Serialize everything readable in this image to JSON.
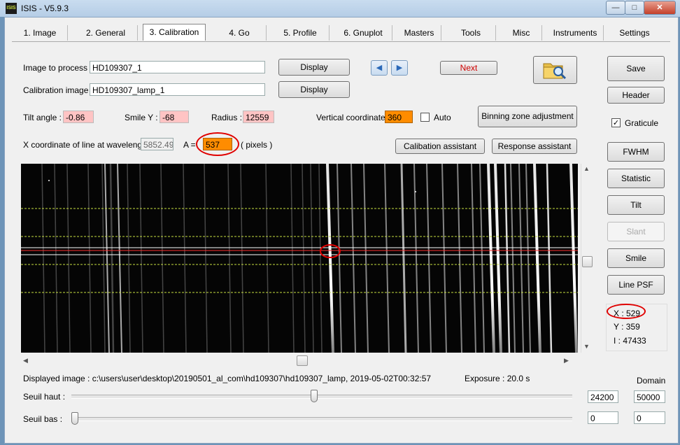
{
  "window": {
    "title": "ISIS - V5.9.3",
    "app_icon_text": "ISIS"
  },
  "tabs": [
    {
      "label": "1. Image"
    },
    {
      "label": "2. General"
    },
    {
      "label": "3. Calibration"
    },
    {
      "label": "4. Go"
    },
    {
      "label": "5. Profile"
    },
    {
      "label": "6. Gnuplot"
    },
    {
      "label": "Masters"
    },
    {
      "label": "Tools"
    },
    {
      "label": "Misc"
    },
    {
      "label": "Instruments"
    },
    {
      "label": "Settings"
    }
  ],
  "form": {
    "image_to_process_label": "Image to process :",
    "image_to_process_value": "HD109307_1",
    "calibration_image_label": "Calibration image :",
    "calibration_image_value": "HD109307_lamp_1",
    "display_label": "Display",
    "next_label": "Next",
    "tilt_label": "Tilt angle :",
    "tilt_value": "-0.86",
    "smile_label": "Smile Y :",
    "smile_value": "-68",
    "radius_label": "Radius :",
    "radius_value": "12559",
    "vertical_label": "Vertical coordinate :",
    "vertical_value": "360",
    "auto_label": "Auto",
    "binning_label": "Binning zone adjustment",
    "xcoord_label": "X coordinate of line at wavelength",
    "wavelength_value": "5852.49",
    "a_label": "A =",
    "pixel_value": "537",
    "pixels_label": "( pixels )",
    "calib_assistant_label": "Calibation assistant",
    "response_assistant_label": "Response assistant"
  },
  "sidebar": {
    "save": "Save",
    "header": "Header",
    "graticule": "Graticule",
    "fwhm": "FWHM",
    "statistic": "Statistic",
    "tilt": "Tilt",
    "slant": "Slant",
    "smile": "Smile",
    "line_psf": "Line PSF"
  },
  "readout": {
    "x": "X : 529",
    "y": "Y : 359",
    "i": "I : 47433"
  },
  "bottom": {
    "displayed_image": "Displayed image : c:\\users\\user\\desktop\\20190501_al_com\\hd109307\\hd109307_lamp, 2019-05-02T00:32:57",
    "exposure": "Exposure : 20.0 s",
    "domain_label": "Domain",
    "seuil_haut_label": "Seuil haut :",
    "seuil_haut_value": "24200",
    "domain_high": "50000",
    "seuil_bas_label": "Seuil bas :",
    "seuil_bas_value": "0",
    "domain_low": "0",
    "seuil_haut_level": 0.484,
    "seuil_bas_level": 0.0
  },
  "colors": {
    "accent_orange": "#ff8c00",
    "pink_field": "#ffc4c4",
    "annotation_red": "#e00000",
    "guide_green": "#c8e040"
  }
}
